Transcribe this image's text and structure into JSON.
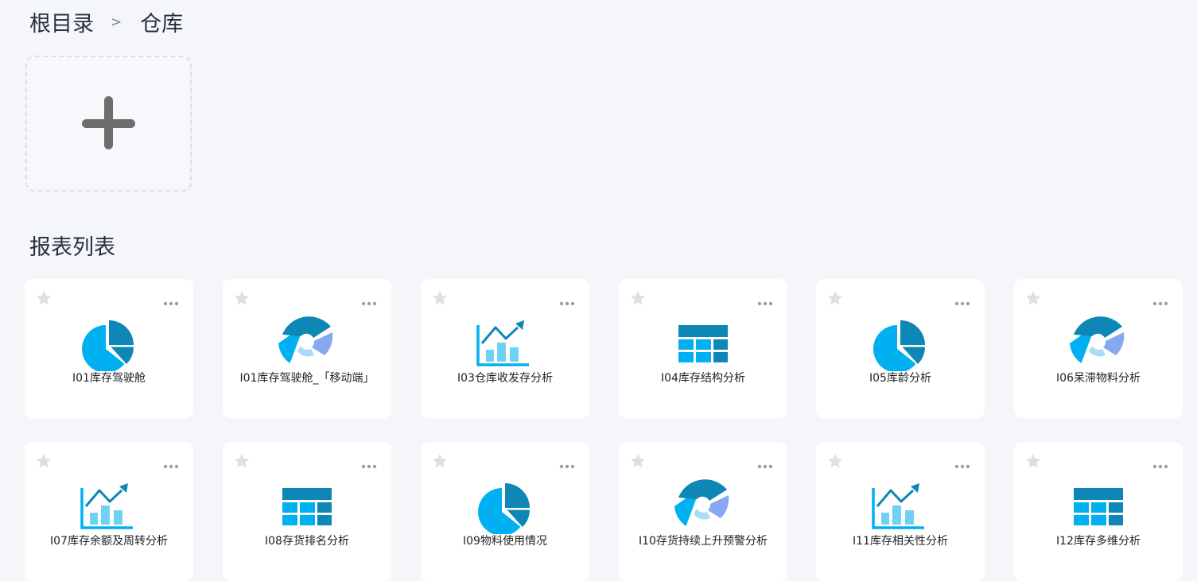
{
  "breadcrumb": {
    "root": "根目录",
    "separator": ">",
    "current": "仓库"
  },
  "section": {
    "title": "报表列表"
  },
  "add_card": {
    "icon": "plus-icon"
  },
  "colors": {
    "primary": "#00b0f0",
    "dark": "#0e86b6",
    "light": "#86a8f0",
    "pale": "#a8dcf6"
  },
  "reports": [
    {
      "label": "I01库存驾驶舱",
      "icon": "pie-chart-icon"
    },
    {
      "label": "I01库存驾驶舱_「移动端」",
      "icon": "donut-chart-icon"
    },
    {
      "label": "I03仓库收发存分析",
      "icon": "line-bar-chart-icon"
    },
    {
      "label": "I04库存结构分析",
      "icon": "table-icon"
    },
    {
      "label": "I05库龄分析",
      "icon": "pie-chart-icon"
    },
    {
      "label": "I06呆滞物料分析",
      "icon": "donut-chart-icon"
    },
    {
      "label": "I07库存余额及周转分析",
      "icon": "line-bar-chart-icon"
    },
    {
      "label": "I08存货排名分析",
      "icon": "table-icon"
    },
    {
      "label": "I09物料使用情况",
      "icon": "pie-chart-icon"
    },
    {
      "label": "I10存货持续上升预警分析",
      "icon": "donut-chart-icon"
    },
    {
      "label": "I11库存相关性分析",
      "icon": "line-bar-chart-icon"
    },
    {
      "label": "I12库存多维分析",
      "icon": "table-icon"
    }
  ]
}
